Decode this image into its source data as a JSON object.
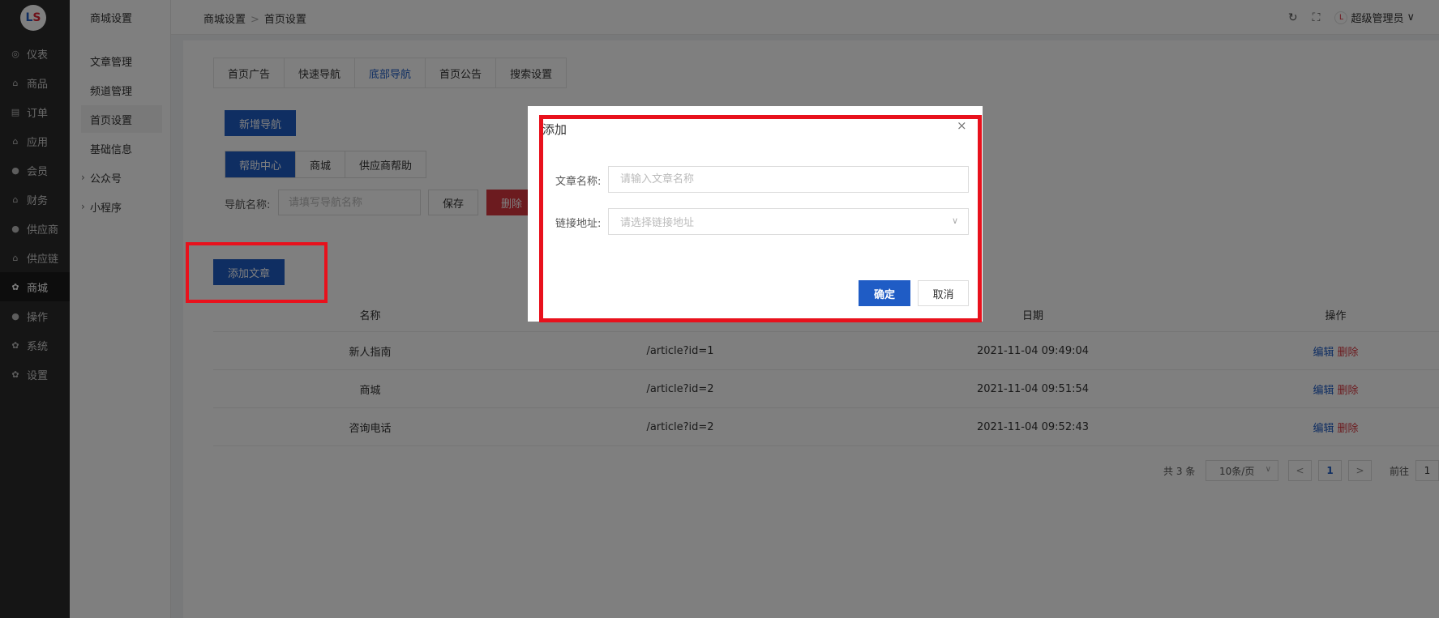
{
  "sidebar": {
    "logo": "LS",
    "items": [
      {
        "label": "仪表",
        "icon": "dashboard-icon",
        "glyph": "◎"
      },
      {
        "label": "商品",
        "icon": "bag-icon",
        "glyph": "⌂"
      },
      {
        "label": "订单",
        "icon": "clipboard-icon",
        "glyph": "▤"
      },
      {
        "label": "应用",
        "icon": "bag-icon",
        "glyph": "⌂"
      },
      {
        "label": "会员",
        "icon": "user-icon",
        "glyph": "●"
      },
      {
        "label": "财务",
        "icon": "bag-icon",
        "glyph": "⌂"
      },
      {
        "label": "供应商",
        "icon": "user-icon",
        "glyph": "●"
      },
      {
        "label": "供应链",
        "icon": "bag-icon",
        "glyph": "⌂"
      },
      {
        "label": "商城",
        "icon": "gear-icon",
        "glyph": "✿"
      },
      {
        "label": "操作",
        "icon": "user-icon",
        "glyph": "●"
      },
      {
        "label": "系统",
        "icon": "gear-icon",
        "glyph": "✿"
      },
      {
        "label": "设置",
        "icon": "gear-icon",
        "glyph": "✿"
      }
    ],
    "active_index": 8
  },
  "submenu": {
    "title": "商城设置",
    "items": [
      {
        "label": "文章管理"
      },
      {
        "label": "频道管理"
      },
      {
        "label": "首页设置"
      },
      {
        "label": "基础信息"
      },
      {
        "label": "公众号",
        "expandable": true
      },
      {
        "label": "小程序",
        "expandable": true
      }
    ],
    "active_index": 2
  },
  "topbar": {
    "breadcrumb": [
      "商城设置",
      "首页设置"
    ],
    "breadcrumb_sep": ">",
    "refresh_glyph": "↻",
    "fullscreen_glyph": "⛶",
    "user_name": "超级管理员",
    "user_caret": "∨"
  },
  "tabs": {
    "items": [
      "首页广告",
      "快速导航",
      "底部导航",
      "首页公告",
      "搜索设置"
    ],
    "active_index": 2
  },
  "panel": {
    "new_nav_button": "新增导航",
    "segments": [
      "帮助中心",
      "商城",
      "供应商帮助"
    ],
    "active_segment": 0,
    "nav_name_label": "导航名称:",
    "nav_name_placeholder": "请填写导航名称",
    "save_button": "保存",
    "delete_button": "删除"
  },
  "add_article_button": "添加文章",
  "table": {
    "headers": [
      "名称",
      "",
      "日期",
      "操作"
    ],
    "rows": [
      {
        "name": "新人指南",
        "link": "/article?id=1",
        "date": "2021-11-04 09:49:04"
      },
      {
        "name": "商城",
        "link": "/article?id=2",
        "date": "2021-11-04 09:51:54"
      },
      {
        "name": "咨询电话",
        "link": "/article?id=2",
        "date": "2021-11-04 09:52:43"
      }
    ],
    "edit_label": "编辑",
    "delete_label": "删除"
  },
  "pagination": {
    "total": "共 3 条",
    "page_size": "10条/页",
    "prev": "<",
    "next": ">",
    "current_page": "1",
    "goto_label": "前往",
    "goto_value": "1"
  },
  "modal": {
    "title": "添加",
    "close_glyph": "×",
    "name_label": "文章名称:",
    "name_placeholder": "请输入文章名称",
    "link_label": "链接地址:",
    "link_placeholder": "请选择链接地址",
    "confirm_button": "确定",
    "cancel_button": "取消"
  },
  "colors": {
    "primary": "#1f5cc5",
    "danger": "#d9363e",
    "highlight": "#e8111c",
    "sidebar_bg": "#2b2b2b"
  }
}
